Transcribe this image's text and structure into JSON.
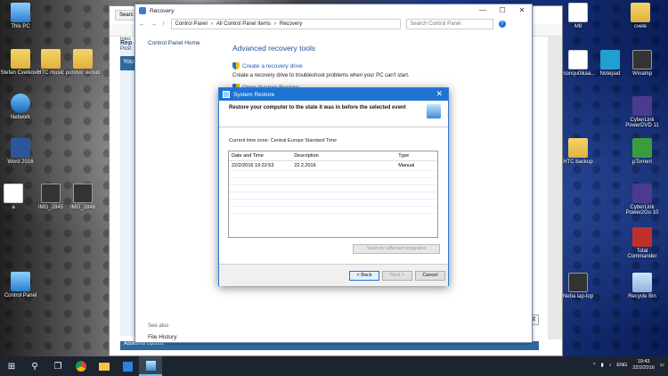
{
  "desktop": {
    "left_icons": [
      {
        "label": "This PC",
        "icon": "pc-icon"
      },
      {
        "label": "Stefan Cvetkovic",
        "icon": "folder-icon"
      },
      {
        "label": "HTC music",
        "icon": "folder-icon"
      },
      {
        "label": "ponovo skinuti",
        "icon": "folder-icon"
      },
      {
        "label": "Network",
        "icon": "network-icon"
      },
      {
        "label": "Word 2016",
        "icon": "word-icon"
      },
      {
        "label": "a",
        "icon": "image-icon"
      },
      {
        "label": "IMG_2845",
        "icon": "image-icon"
      },
      {
        "label": "IMG_2846",
        "icon": "image-icon"
      },
      {
        "label": "Control Panel",
        "icon": "control-panel-icon"
      }
    ],
    "right_icons": [
      {
        "label": "M8",
        "icon": "doc-icon"
      },
      {
        "label": "cvele",
        "icon": "folder-icon"
      },
      {
        "label": "vsonqu0ikaa...",
        "icon": "image-icon"
      },
      {
        "label": "Notepad",
        "icon": "notepad-icon"
      },
      {
        "label": "Winamp",
        "icon": "winamp-icon"
      },
      {
        "label": "CyberLink PowerDVD 11",
        "icon": "powerdvd-icon"
      },
      {
        "label": "HTC backup",
        "icon": "folder-icon"
      },
      {
        "label": "µTorrent",
        "icon": "utorrent-icon"
      },
      {
        "label": "CyberLink Power2Go 10",
        "icon": "power2go-icon"
      },
      {
        "label": "Total Commander",
        "icon": "totalcmd-icon"
      },
      {
        "label": "Neba lap-top",
        "icon": "image-icon"
      },
      {
        "label": "Recycle Bin",
        "icon": "recycle-bin-icon"
      }
    ]
  },
  "browser": {
    "tab_label": "Searc",
    "left_texts": [
      "Rep",
      "Post",
      "You",
      "Intes"
    ],
    "post_button": "Post",
    "footer_text": "Additional Options"
  },
  "control_panel": {
    "title": "Recovery",
    "window_controls": [
      "—",
      "☐",
      "✕"
    ],
    "nav": [
      "←",
      "→",
      "↑"
    ],
    "breadcrumb": [
      "Control Panel",
      "All Control Panel Items",
      "Recovery"
    ],
    "search_placeholder": "Search Control Panel",
    "help": "?",
    "sidebar_home": "Control Panel Home",
    "heading": "Advanced recovery tools",
    "link1": "Create a recovery drive",
    "desc1": "Create a recovery drive to troubleshoot problems when your PC can't start.",
    "link2": "Open System Restore",
    "see_also": "See also",
    "file_history": "File History"
  },
  "system_restore": {
    "title": "System Restore",
    "close": "✕",
    "header_text": "Restore your computer to the state it was in before the selected event",
    "timezone": "Current time zone: Central Europe Standard Time",
    "columns": [
      "Date and Time",
      "Description",
      "Type"
    ],
    "rows": [
      {
        "date": "22/2/2016 19:22:53",
        "description": "22.2.2016",
        "type": "Manual"
      }
    ],
    "scan_button": "Scan for affected programs",
    "back_button": "< Back",
    "next_button": "Next >",
    "cancel_button": "Cancel"
  },
  "taskbar": {
    "start": "⊞",
    "search": "⚲",
    "taskview": "❐",
    "apps": [
      "chrome-icon",
      "file-explorer-icon",
      "store-icon",
      "system-restore-icon"
    ],
    "language": "ENG",
    "time": "19:43",
    "date": "22/2/2016"
  }
}
